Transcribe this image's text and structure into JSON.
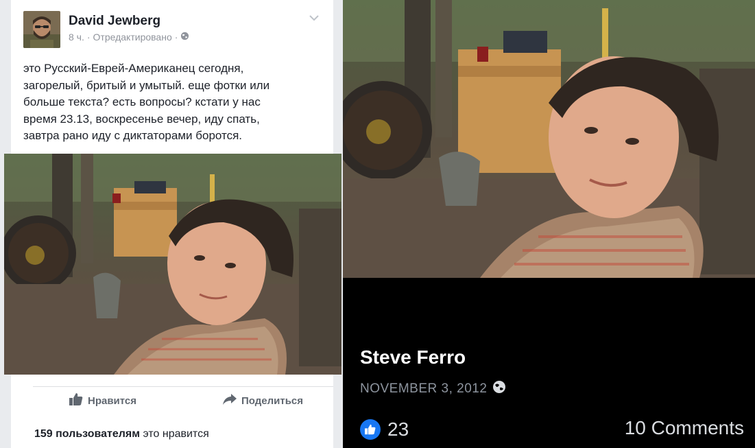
{
  "post": {
    "author_name": "David Jewberg",
    "time": "8 ч.",
    "edited": "Отредактировано",
    "separator": "·",
    "lines": [
      "это Русский-Еврей-Американец сегодня,",
      "загорелый, бритый и умытый.  еще фотки или",
      "больше текста?  есть вопросы?  кстати у нас",
      "время 23.13, воскресенье вечер, иду спать,",
      "завтра рано иду с диктаторами боротся."
    ],
    "like_label": "Нравится",
    "share_label": "Поделиться",
    "likes_count_bold": "159 пользователям",
    "likes_suffix": " это нравится"
  },
  "photo_view": {
    "author_name": "Steve Ferro",
    "date": "NOVEMBER 3, 2012",
    "like_count": "23",
    "comments": "10 Comments"
  },
  "icons": {
    "privacy": "globe-icon",
    "like": "thumbs-up-icon",
    "share": "share-arrow-icon",
    "menu": "chevron-down-icon"
  },
  "colors": {
    "facebook_blue": "#1877f2",
    "meta_gray": "#90949c"
  }
}
